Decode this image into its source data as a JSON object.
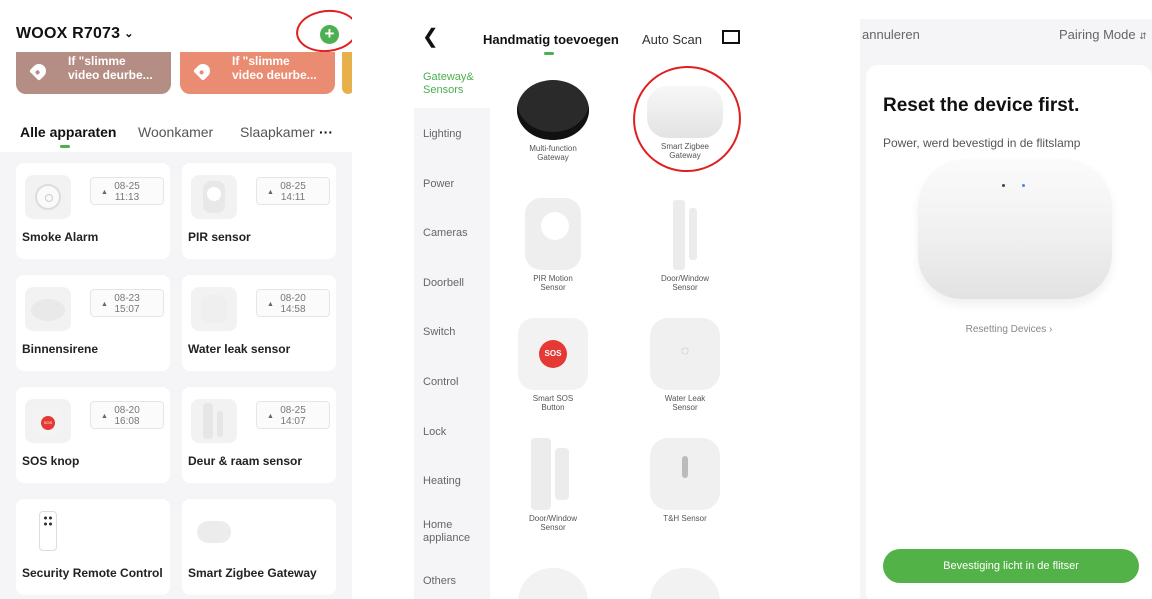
{
  "panel1": {
    "home_name": "WOOX R7073",
    "banners": [
      {
        "line1": "If \"slimme",
        "line2": "video deurbe..."
      },
      {
        "line1": "If \"slimme",
        "line2": "video deurbe..."
      }
    ],
    "tabs": [
      "Alle apparaten",
      "Woonkamer",
      "Slaapkamer"
    ],
    "more": "···",
    "devices": [
      {
        "name": "Smoke Alarm",
        "date": "08-25",
        "time": "11:13",
        "icon": "smoke-alarm-icon"
      },
      {
        "name": "PIR sensor",
        "date": "08-25",
        "time": "14:11",
        "icon": "pir-sensor-icon"
      },
      {
        "name": "Binnensirene",
        "date": "08-23",
        "time": "15:07",
        "icon": "siren-icon"
      },
      {
        "name": "Water leak sensor",
        "date": "08-20",
        "time": "14:58",
        "icon": "water-sensor-icon"
      },
      {
        "name": "SOS knop",
        "date": "08-20",
        "time": "16:08",
        "icon": "sos-button-icon"
      },
      {
        "name": "Deur & raam sensor",
        "date": "08-25",
        "time": "14:07",
        "icon": "door-sensor-icon"
      },
      {
        "name": "Security Remote Control",
        "date": "",
        "time": "",
        "icon": "remote-icon"
      },
      {
        "name": "Smart Zigbee Gateway",
        "date": "",
        "time": "",
        "icon": "gateway-icon"
      }
    ],
    "accent": "#4caf50"
  },
  "panel2": {
    "tab_manual": "Handmatig toevoegen",
    "tab_auto": "Auto Scan",
    "categories": [
      "Gateway&\nSensors",
      "Lighting",
      "Power",
      "Cameras",
      "Doorbell",
      "Switch",
      "Control",
      "Lock",
      "Heating",
      "Home\nappliance",
      "Others"
    ],
    "products": [
      {
        "line1": "Multi-function",
        "line2": "Gateway"
      },
      {
        "line1": "Smart Zigbee",
        "line2": "Gateway"
      },
      {
        "line1": "PIR Motion",
        "line2": "Sensor"
      },
      {
        "line1": "Door/Window",
        "line2": "Sensor"
      },
      {
        "line1": "Smart SOS",
        "line2": "Button"
      },
      {
        "line1": "Water Leak",
        "line2": "Sensor"
      },
      {
        "line1": "Door/Window",
        "line2": "Sensor"
      },
      {
        "line1": "T&H Sensor",
        "line2": ""
      }
    ]
  },
  "panel3": {
    "cancel": "annuleren",
    "pairing_mode": "Pairing Mode",
    "title": "Reset the device first.",
    "subtitle": "Power, werd bevestigd in de flitslamp",
    "resetting_link": "Resetting Devices",
    "confirm_button": "Bevestiging licht in de flitser",
    "button_color": "#52b247"
  }
}
